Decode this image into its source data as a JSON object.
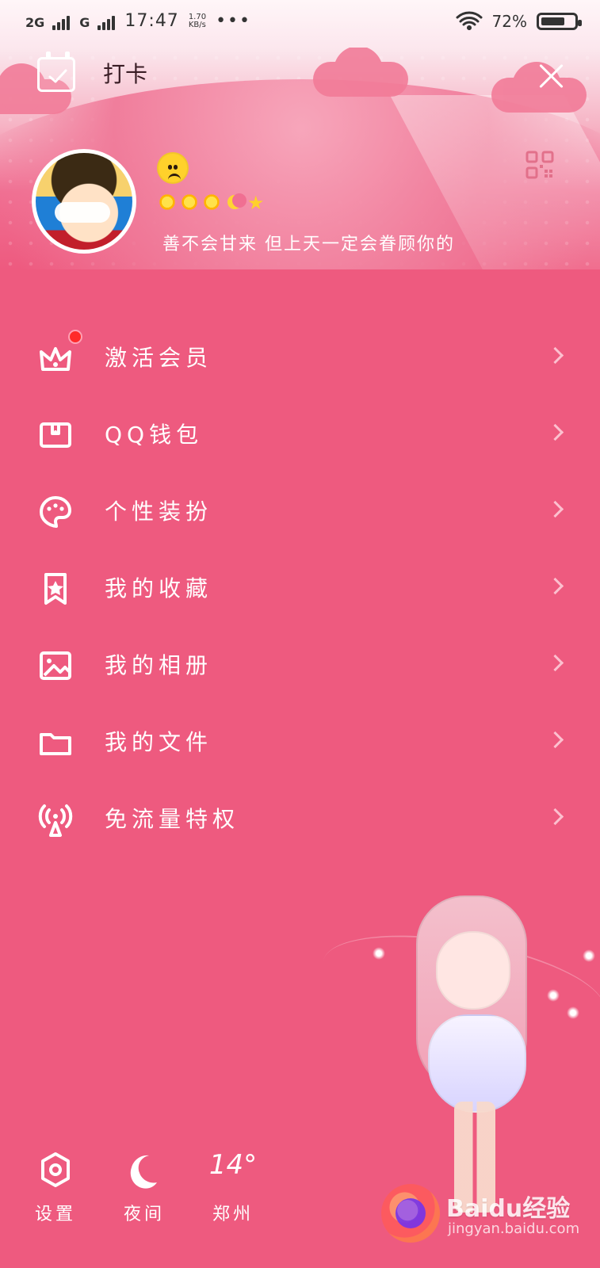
{
  "status_bar": {
    "network_1": "2G",
    "network_2": "G",
    "time": "17:47",
    "speed": "1.70\nKB/s",
    "more": "•••",
    "battery_percent": "72%"
  },
  "header": {
    "checkin_label": "打卡"
  },
  "profile": {
    "signature": "善不会甘来 但上天一定会眷顾你的"
  },
  "menu": {
    "items": [
      {
        "label": "激活会员"
      },
      {
        "label": "QQ钱包"
      },
      {
        "label": "个性装扮"
      },
      {
        "label": "我的收藏"
      },
      {
        "label": "我的相册"
      },
      {
        "label": "我的文件"
      },
      {
        "label": "免流量特权"
      }
    ]
  },
  "bottom": {
    "settings_label": "设置",
    "night_label": "夜间",
    "temp": "14°",
    "city": "郑州"
  },
  "watermark": {
    "brand": "Baidu经验",
    "url": "jingyan.baidu.com"
  },
  "icons": {
    "checkin": "calendar-check-icon",
    "close": "close-icon",
    "qr": "qr-code-icon",
    "mood": "sad-face-icon",
    "vip": "crown-icon",
    "wallet": "wallet-icon",
    "theme": "palette-icon",
    "favorites": "bookmark-star-icon",
    "album": "image-icon",
    "files": "folder-icon",
    "data_free": "broadcast-tower-icon",
    "settings": "hexagon-settings-icon",
    "night": "moon-icon"
  },
  "colors": {
    "background": "#ee5a7f",
    "badge": "#ff2a2a"
  }
}
